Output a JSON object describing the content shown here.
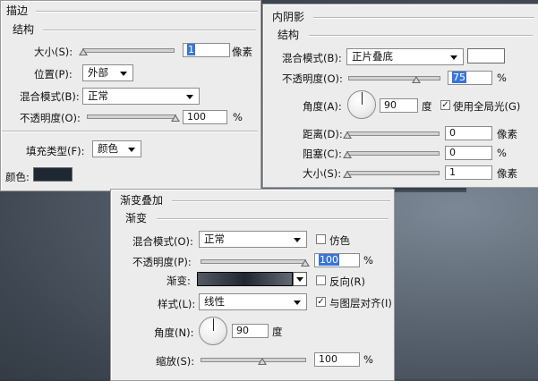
{
  "stroke": {
    "title": "描边",
    "group": "结构",
    "size_label": "大小(S):",
    "size_value": "1",
    "size_unit": "像素",
    "size_slider": 0.01,
    "position_label": "位置(P):",
    "position_value": "外部",
    "blend_label": "混合模式(B):",
    "blend_value": "正常",
    "opacity_label": "不透明度(O):",
    "opacity_value": "100",
    "opacity_unit": "%",
    "opacity_slider": 1.0,
    "fill_type_label": "填充类型(F):",
    "fill_type_value": "颜色",
    "color_label": "颜色:",
    "color": "#1e2833"
  },
  "inner_shadow": {
    "title": "内阴影",
    "group": "结构",
    "blend_label": "混合模式(B):",
    "blend_value": "正片叠底",
    "blend_color": "#ffffff",
    "opacity_label": "不透明度(O):",
    "opacity_value": "75",
    "opacity_unit": "%",
    "opacity_slider": 0.75,
    "angle_label": "角度(A):",
    "angle_value": "90",
    "angle_unit": "度",
    "global_light_label": "使用全局光(G)",
    "global_light_checked": "✓",
    "distance_label": "距离(D):",
    "distance_value": "0",
    "distance_unit": "像素",
    "choke_label": "阻塞(C):",
    "choke_value": "0",
    "choke_unit": "%",
    "size_label": "大小(S):",
    "size_value": "1",
    "size_unit": "像素"
  },
  "gradient_overlay": {
    "title": "渐变叠加",
    "group": "渐变",
    "blend_label": "混合模式(O):",
    "blend_value": "正常",
    "dither_label": "仿色",
    "opacity_label": "不透明度(P):",
    "opacity_value": "100",
    "opacity_unit": "%",
    "opacity_slider": 1.0,
    "gradient_label": "渐变:",
    "reverse_label": "反向(R)",
    "style_label": "样式(L):",
    "style_value": "线性",
    "align_label": "与图层对齐(I)",
    "align_checked": "✓",
    "angle_label": "角度(N):",
    "angle_value": "90",
    "angle_unit": "度",
    "scale_label": "缩放(S):",
    "scale_value": "100",
    "scale_unit": "%",
    "scale_slider": 0.5
  }
}
